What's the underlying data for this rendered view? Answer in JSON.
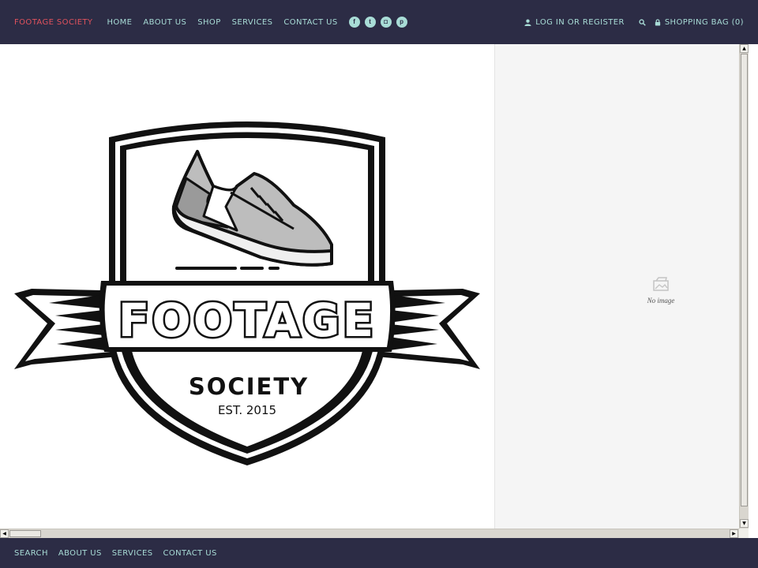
{
  "header": {
    "brand": "FOOTAGE SOCIETY",
    "nav": [
      "HOME",
      "ABOUT US",
      "SHOP",
      "SERVICES",
      "CONTACT US"
    ],
    "social": [
      {
        "icon": "facebook-icon",
        "glyph": "f"
      },
      {
        "icon": "twitter-icon",
        "glyph": "t"
      },
      {
        "icon": "instagram-icon",
        "glyph": "◘"
      },
      {
        "icon": "pinterest-icon",
        "glyph": "p"
      }
    ],
    "login": "LOG IN OR REGISTER",
    "cart": "SHOPPING BAG (0)"
  },
  "logo": {
    "title": "FOOTAGE",
    "subtitle": "SOCIETY",
    "est": "EST. 2015"
  },
  "product": {
    "no_image": "No image"
  },
  "footer": {
    "links": [
      "SEARCH",
      "ABOUT US",
      "SERVICES",
      "CONTACT US"
    ]
  },
  "colors": {
    "bar_bg": "#2c2c45",
    "brand": "#e0525d",
    "link": "#a8dcd6",
    "side_bg": "#f5f5f5"
  }
}
